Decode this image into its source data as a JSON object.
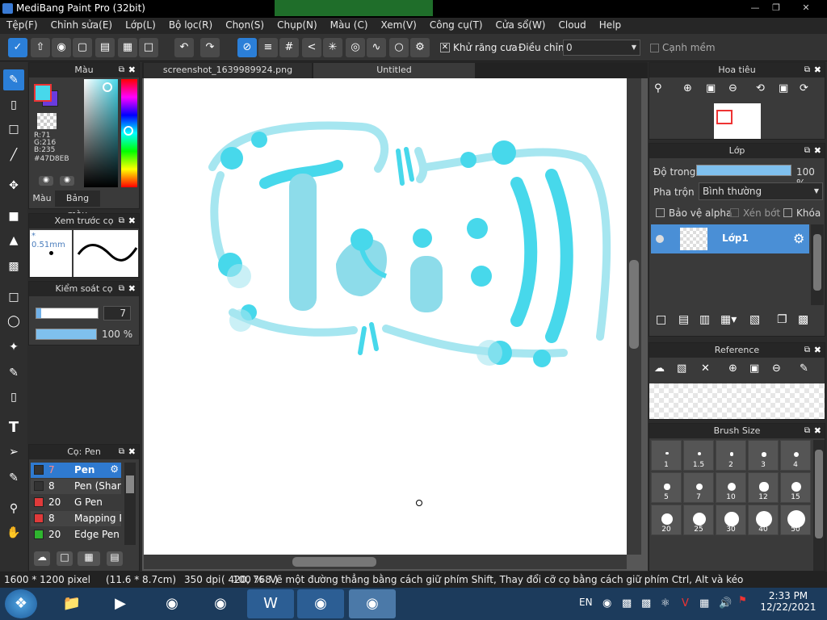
{
  "window": {
    "title": "MediBang Paint Pro (32bit)"
  },
  "menu": [
    "Tệp(F)",
    "Chỉnh sửa(E)",
    "Lớp(L)",
    "Bộ lọc(R)",
    "Chọn(S)",
    "Chụp(N)",
    "Màu (C)",
    "Xem(V)",
    "Công cụ(T)",
    "Cửa sổ(W)",
    "Cloud",
    "Help"
  ],
  "toolbar": {
    "antialias_label": "Khử răng cưa",
    "adjust_label": "Điều chỉnh",
    "adjust_value": "0",
    "soft_edge_label": "Cạnh mềm"
  },
  "color_panel": {
    "title": "Màu",
    "r": "R:71",
    "g": "G:216",
    "b": "B:235",
    "hex": "#47D8EB",
    "tab_color": "Màu",
    "tab_palette": "Bảng màu",
    "fg": "#47D8EB",
    "bg": "#6a3bde"
  },
  "brush_preview": {
    "title": "Xem trước cọ",
    "size": "* 0.51mm"
  },
  "brush_control": {
    "title": "Kiểm soát cọ",
    "size": "7",
    "opacity": "100 %"
  },
  "brush_list": {
    "title": "Cọ: Pen",
    "items": [
      {
        "size": "7",
        "name": "Pen",
        "color": "#333333"
      },
      {
        "size": "8",
        "name": "Pen (Sharp)",
        "color": "#333333"
      },
      {
        "size": "20",
        "name": "G Pen",
        "color": "#e03a3a"
      },
      {
        "size": "8",
        "name": "Mapping Pen",
        "color": "#e03a3a"
      },
      {
        "size": "20",
        "name": "Edge Pen",
        "color": "#2fb52f"
      }
    ]
  },
  "tabs": [
    "screenshot_1639989924.png",
    "Untitled"
  ],
  "navigator": {
    "title": "Hoa tiêu"
  },
  "layers": {
    "title": "Lớp",
    "opacity_label": "Độ trong",
    "opacity_value": "100 %",
    "blend_label": "Pha trộn",
    "blend_value": "Bình thường",
    "protect_alpha": "Bảo vệ alpha",
    "clip": "Xén bớt",
    "lock": "Khóa",
    "layer_name": "Lớp1"
  },
  "reference": {
    "title": "Reference"
  },
  "brush_size": {
    "title": "Brush Size",
    "sizes": [
      "1",
      "1.5",
      "2",
      "3",
      "4",
      "5",
      "7",
      "10",
      "12",
      "15",
      "20",
      "25",
      "30",
      "40",
      "50"
    ]
  },
  "status": {
    "dims": "1600 * 1200 pixel",
    "cm": "(11.6 * 8.7cm)",
    "dpi": "350 dpi",
    "zoom": "100 %",
    "coords": "( 420, 768 )",
    "hint": "Vẽ một đường thẳng bằng cách giữ phím Shift, Thay đổi cỡ cọ bằng cách giữ phím Ctrl, Alt và kéo"
  },
  "taskbar": {
    "lang": "EN",
    "time": "2:33 PM",
    "date": "12/22/2021"
  },
  "drawing_color": "#47D8EB"
}
